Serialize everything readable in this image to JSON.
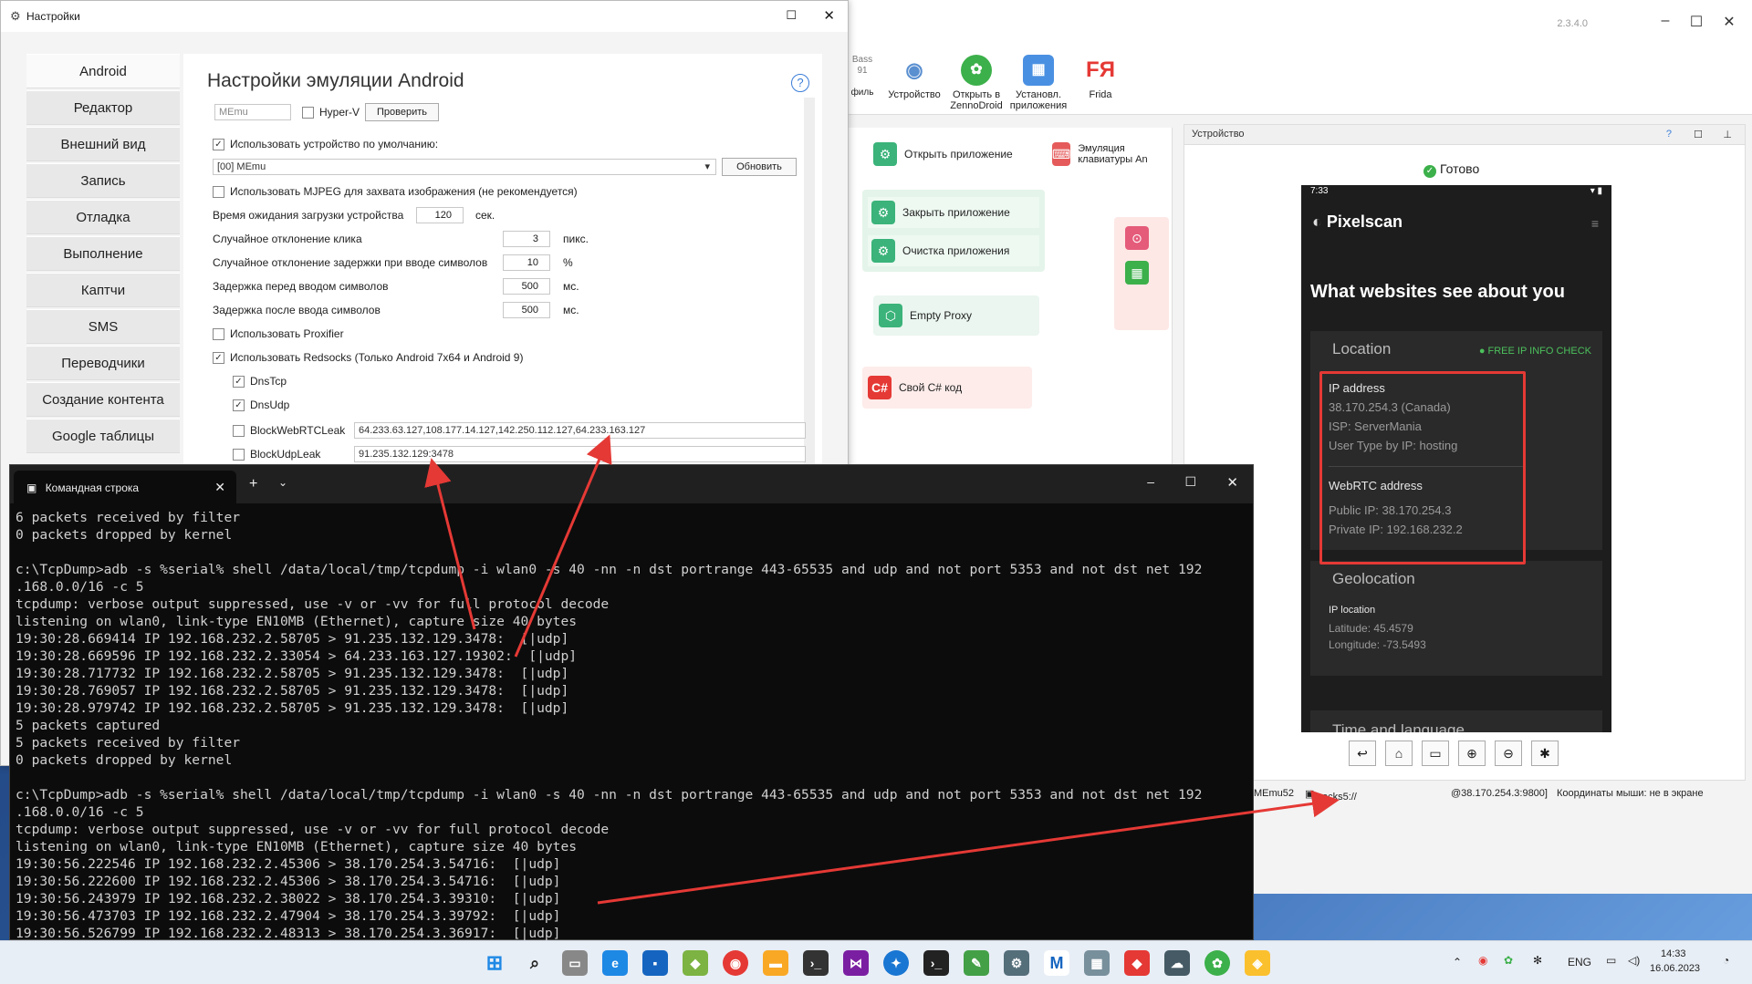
{
  "settings": {
    "window_title": "Настройки",
    "heading": "Настройки эмуляции Android",
    "sidebar": [
      "Android",
      "Редактор",
      "Внешний вид",
      "Запись",
      "Отладка",
      "Выполнение",
      "Каптчи",
      "SMS",
      "Переводчики",
      "Создание контента",
      "Google таблицы"
    ],
    "emulator_field": "MEmu",
    "hyperv_label": "Hyper-V",
    "check_button": "Проверить",
    "use_default_label": "Использовать устройство по умолчанию:",
    "device_select": "[00] MEmu",
    "refresh_button": "Обновить",
    "mjpeg_label": "Использовать MJPEG для захвата изображения (не рекомендуется)",
    "load_wait_label": "Время ожидания загрузки устройства",
    "load_wait_value": "120",
    "load_wait_unit": "сек.",
    "click_dev_label": "Случайное отклонение клика",
    "click_dev_value": "3",
    "click_dev_unit": "пикс.",
    "delay_dev_label": "Случайное отклонение задержки при вводе символов",
    "delay_dev_value": "10",
    "delay_dev_unit": "%",
    "before_label": "Задержка перед вводом символов",
    "before_value": "500",
    "before_unit": "мс.",
    "after_label": "Задержка после ввода символов",
    "after_value": "500",
    "after_unit": "мс.",
    "proxifier_label": "Использовать Proxifier",
    "redsocks_label": "Использовать Redsocks (Только Android 7x64 и Android 9)",
    "dnstcp_label": "DnsTcp",
    "dnsudp_label": "DnsUdp",
    "blockwebrtc_label": "BlockWebRTCLeak",
    "blockwebrtc_value": "64.233.63.127,108.177.14.127,142.250.112.127,64.233.163.127",
    "blockudp_label": "BlockUdpLeak",
    "blockudp_value": "91.235.132.129:3478"
  },
  "console": {
    "tab_title": "Командная строка",
    "lines": [
      "6 packets received by filter",
      "0 packets dropped by kernel",
      "",
      "c:\\TcpDump>adb -s %serial% shell /data/local/tmp/tcpdump -i wlan0 -s 40 -nn -n dst portrange 443-65535 and udp and not port 5353 and not dst net 192",
      ".168.0.0/16 -c 5",
      "tcpdump: verbose output suppressed, use -v or -vv for full protocol decode",
      "listening on wlan0, link-type EN10MB (Ethernet), capture size 40 bytes",
      "19:30:28.669414 IP 192.168.232.2.58705 > 91.235.132.129.3478:  [|udp]",
      "19:30:28.669596 IP 192.168.232.2.33054 > 64.233.163.127.19302:  [|udp]",
      "19:30:28.717732 IP 192.168.232.2.58705 > 91.235.132.129.3478:  [|udp]",
      "19:30:28.769057 IP 192.168.232.2.58705 > 91.235.132.129.3478:  [|udp]",
      "19:30:28.979742 IP 192.168.232.2.58705 > 91.235.132.129.3478:  [|udp]",
      "5 packets captured",
      "5 packets received by filter",
      "0 packets dropped by kernel",
      "",
      "c:\\TcpDump>adb -s %serial% shell /data/local/tmp/tcpdump -i wlan0 -s 40 -nn -n dst portrange 443-65535 and udp and not port 5353 and not dst net 192",
      ".168.0.0/16 -c 5",
      "tcpdump: verbose output suppressed, use -v or -vv for full protocol decode",
      "listening on wlan0, link-type EN10MB (Ethernet), capture size 40 bytes",
      "19:30:56.222546 IP 192.168.232.2.45306 > 38.170.254.3.54716:  [|udp]",
      "19:30:56.222600 IP 192.168.232.2.45306 > 38.170.254.3.54716:  [|udp]",
      "19:30:56.243979 IP 192.168.232.2.38022 > 38.170.254.3.39310:  [|udp]",
      "19:30:56.473703 IP 192.168.232.2.47904 > 38.170.254.3.39792:  [|udp]",
      "19:30:56.526799 IP 192.168.232.2.48313 > 38.170.254.3.36917:  [|udp]"
    ]
  },
  "bgapp": {
    "version": "2.3.4.0",
    "ribbon": [
      {
        "label": "Устройство",
        "icon": "eye-icon",
        "color": "#5a8fd0"
      },
      {
        "label": "Открыть в ZennoDroid",
        "icon": "zennodroid-icon",
        "color": "#3cb04a"
      },
      {
        "label": "Установл. приложения",
        "icon": "apps-icon",
        "color": "#4a90e2"
      },
      {
        "label": "Frida",
        "icon": "frida-icon",
        "color": "#e53935"
      }
    ],
    "ribbon_partial": [
      "Bass",
      "91",
      "филь"
    ],
    "nodes": {
      "open_app": "Открыть приложение",
      "keyboard": "Эмуляция клавиатуры An",
      "close_app": "Закрыть приложение",
      "clear_app": "Очистка приложения",
      "empty_proxy": "Empty Proxy",
      "csharp": "Свой C# код",
      "csharp_icon": "C#"
    },
    "device_panel_title": "Устройство",
    "ready": "Готово",
    "statusbar": {
      "device": "MEmu52",
      "proxy": "[socks5://",
      "proxy_end": "@38.170.254.3:9800]",
      "mouse": "Координаты мыши: не в экране"
    }
  },
  "phone": {
    "time": "7:33",
    "brand": "Pixelscan",
    "hero": "What websites see about you",
    "location_title": "Location",
    "free_check": "FREE IP INFO CHECK",
    "ip_header": "IP address",
    "ip_value": "38.170.254.3 (Canada)",
    "isp": "ISP: ServerMania",
    "user_type": "User Type by IP: hosting",
    "webrtc_header": "WebRTC address",
    "public_ip": "Public IP: 38.170.254.3",
    "private_ip": "Private IP: 192.168.232.2",
    "geo_title": "Geolocation",
    "ip_location": "IP location",
    "latitude": "Latitude: 45.4579",
    "longitude": "Longitude: -73.5493",
    "time_lang": "Time and language"
  },
  "taskbar": {
    "lang": "ENG",
    "time": "14:33",
    "date": "16.06.2023"
  },
  "colors": {
    "arrow": "#e53935",
    "accent_green": "#3bb37a"
  }
}
